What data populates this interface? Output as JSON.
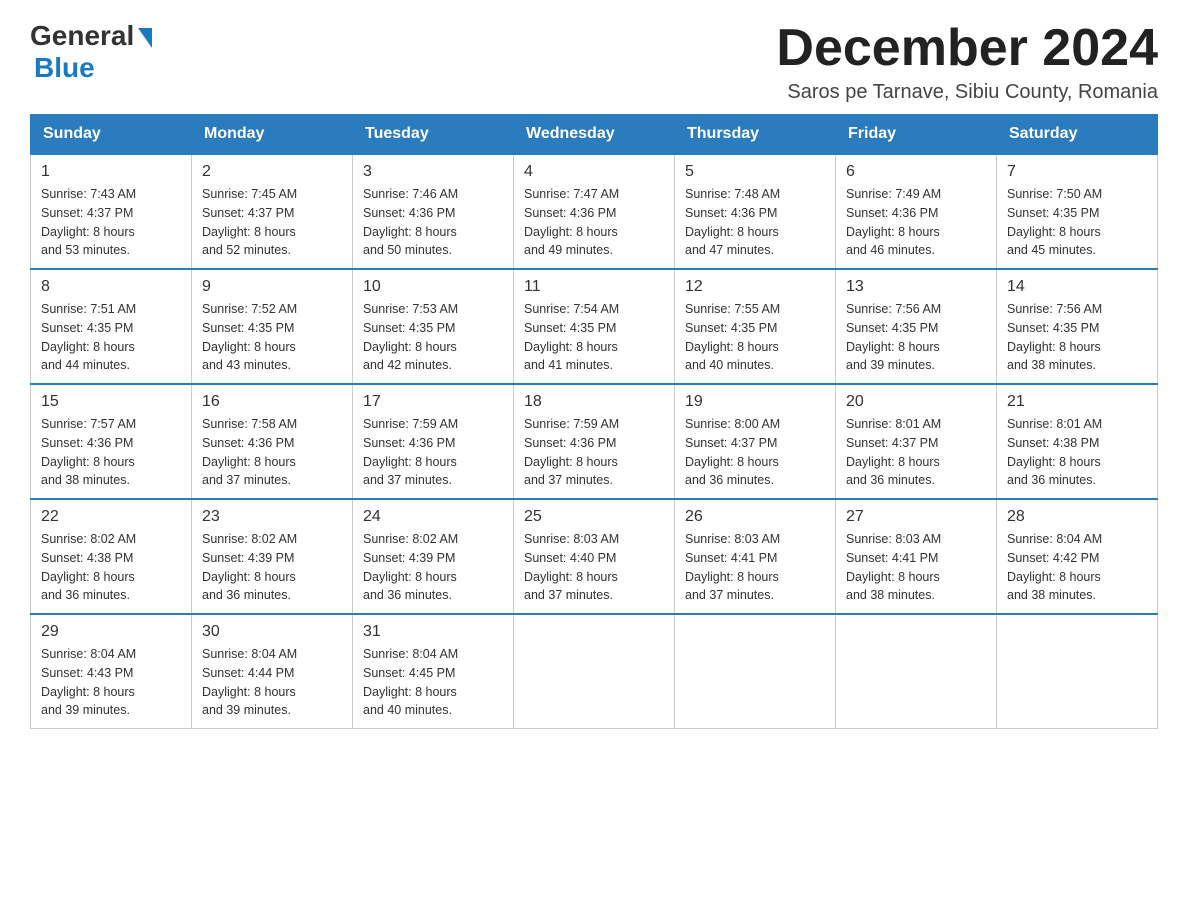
{
  "header": {
    "logo_general": "General",
    "logo_blue": "Blue",
    "month_title": "December 2024",
    "location": "Saros pe Tarnave, Sibiu County, Romania"
  },
  "weekdays": [
    "Sunday",
    "Monday",
    "Tuesday",
    "Wednesday",
    "Thursday",
    "Friday",
    "Saturday"
  ],
  "weeks": [
    [
      {
        "day": "1",
        "sunrise": "7:43 AM",
        "sunset": "4:37 PM",
        "daylight": "8 hours and 53 minutes."
      },
      {
        "day": "2",
        "sunrise": "7:45 AM",
        "sunset": "4:37 PM",
        "daylight": "8 hours and 52 minutes."
      },
      {
        "day": "3",
        "sunrise": "7:46 AM",
        "sunset": "4:36 PM",
        "daylight": "8 hours and 50 minutes."
      },
      {
        "day": "4",
        "sunrise": "7:47 AM",
        "sunset": "4:36 PM",
        "daylight": "8 hours and 49 minutes."
      },
      {
        "day": "5",
        "sunrise": "7:48 AM",
        "sunset": "4:36 PM",
        "daylight": "8 hours and 47 minutes."
      },
      {
        "day": "6",
        "sunrise": "7:49 AM",
        "sunset": "4:36 PM",
        "daylight": "8 hours and 46 minutes."
      },
      {
        "day": "7",
        "sunrise": "7:50 AM",
        "sunset": "4:35 PM",
        "daylight": "8 hours and 45 minutes."
      }
    ],
    [
      {
        "day": "8",
        "sunrise": "7:51 AM",
        "sunset": "4:35 PM",
        "daylight": "8 hours and 44 minutes."
      },
      {
        "day": "9",
        "sunrise": "7:52 AM",
        "sunset": "4:35 PM",
        "daylight": "8 hours and 43 minutes."
      },
      {
        "day": "10",
        "sunrise": "7:53 AM",
        "sunset": "4:35 PM",
        "daylight": "8 hours and 42 minutes."
      },
      {
        "day": "11",
        "sunrise": "7:54 AM",
        "sunset": "4:35 PM",
        "daylight": "8 hours and 41 minutes."
      },
      {
        "day": "12",
        "sunrise": "7:55 AM",
        "sunset": "4:35 PM",
        "daylight": "8 hours and 40 minutes."
      },
      {
        "day": "13",
        "sunrise": "7:56 AM",
        "sunset": "4:35 PM",
        "daylight": "8 hours and 39 minutes."
      },
      {
        "day": "14",
        "sunrise": "7:56 AM",
        "sunset": "4:35 PM",
        "daylight": "8 hours and 38 minutes."
      }
    ],
    [
      {
        "day": "15",
        "sunrise": "7:57 AM",
        "sunset": "4:36 PM",
        "daylight": "8 hours and 38 minutes."
      },
      {
        "day": "16",
        "sunrise": "7:58 AM",
        "sunset": "4:36 PM",
        "daylight": "8 hours and 37 minutes."
      },
      {
        "day": "17",
        "sunrise": "7:59 AM",
        "sunset": "4:36 PM",
        "daylight": "8 hours and 37 minutes."
      },
      {
        "day": "18",
        "sunrise": "7:59 AM",
        "sunset": "4:36 PM",
        "daylight": "8 hours and 37 minutes."
      },
      {
        "day": "19",
        "sunrise": "8:00 AM",
        "sunset": "4:37 PM",
        "daylight": "8 hours and 36 minutes."
      },
      {
        "day": "20",
        "sunrise": "8:01 AM",
        "sunset": "4:37 PM",
        "daylight": "8 hours and 36 minutes."
      },
      {
        "day": "21",
        "sunrise": "8:01 AM",
        "sunset": "4:38 PM",
        "daylight": "8 hours and 36 minutes."
      }
    ],
    [
      {
        "day": "22",
        "sunrise": "8:02 AM",
        "sunset": "4:38 PM",
        "daylight": "8 hours and 36 minutes."
      },
      {
        "day": "23",
        "sunrise": "8:02 AM",
        "sunset": "4:39 PM",
        "daylight": "8 hours and 36 minutes."
      },
      {
        "day": "24",
        "sunrise": "8:02 AM",
        "sunset": "4:39 PM",
        "daylight": "8 hours and 36 minutes."
      },
      {
        "day": "25",
        "sunrise": "8:03 AM",
        "sunset": "4:40 PM",
        "daylight": "8 hours and 37 minutes."
      },
      {
        "day": "26",
        "sunrise": "8:03 AM",
        "sunset": "4:41 PM",
        "daylight": "8 hours and 37 minutes."
      },
      {
        "day": "27",
        "sunrise": "8:03 AM",
        "sunset": "4:41 PM",
        "daylight": "8 hours and 38 minutes."
      },
      {
        "day": "28",
        "sunrise": "8:04 AM",
        "sunset": "4:42 PM",
        "daylight": "8 hours and 38 minutes."
      }
    ],
    [
      {
        "day": "29",
        "sunrise": "8:04 AM",
        "sunset": "4:43 PM",
        "daylight": "8 hours and 39 minutes."
      },
      {
        "day": "30",
        "sunrise": "8:04 AM",
        "sunset": "4:44 PM",
        "daylight": "8 hours and 39 minutes."
      },
      {
        "day": "31",
        "sunrise": "8:04 AM",
        "sunset": "4:45 PM",
        "daylight": "8 hours and 40 minutes."
      },
      null,
      null,
      null,
      null
    ]
  ],
  "labels": {
    "sunrise_prefix": "Sunrise: ",
    "sunset_prefix": "Sunset: ",
    "daylight_prefix": "Daylight: "
  }
}
